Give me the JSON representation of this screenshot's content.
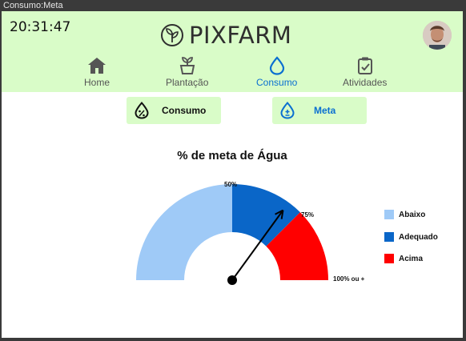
{
  "window": {
    "title": "Consumo:Meta"
  },
  "header": {
    "clock": "20:31:47",
    "brand": "PIXFARM",
    "nav": [
      {
        "label": "Home",
        "icon": "home-icon",
        "active": false
      },
      {
        "label": "Plantação",
        "icon": "plant-pot-icon",
        "active": false
      },
      {
        "label": "Consumo",
        "icon": "water-drop-icon",
        "active": true
      },
      {
        "label": "Atividades",
        "icon": "clipboard-check-icon",
        "active": false
      }
    ]
  },
  "subnav": {
    "consumo_label": "Consumo",
    "meta_label": "Meta"
  },
  "chart_data": {
    "type": "gauge",
    "title": "% de meta de Água",
    "ticks": [
      "50%",
      "75%",
      "100% ou +"
    ],
    "bands": [
      {
        "name": "Abaixo",
        "from": 0,
        "to": 50,
        "color": "#9fcaf7"
      },
      {
        "name": "Adequado",
        "from": 50,
        "to": 75,
        "color": "#0a66c8"
      },
      {
        "name": "Acima",
        "from": 75,
        "to": 100,
        "color": "#ff0000"
      }
    ],
    "needle_value": 70,
    "range": [
      0,
      100
    ]
  },
  "colors": {
    "header_bg": "#d9fcc8",
    "active_nav": "#0a6fd1"
  }
}
